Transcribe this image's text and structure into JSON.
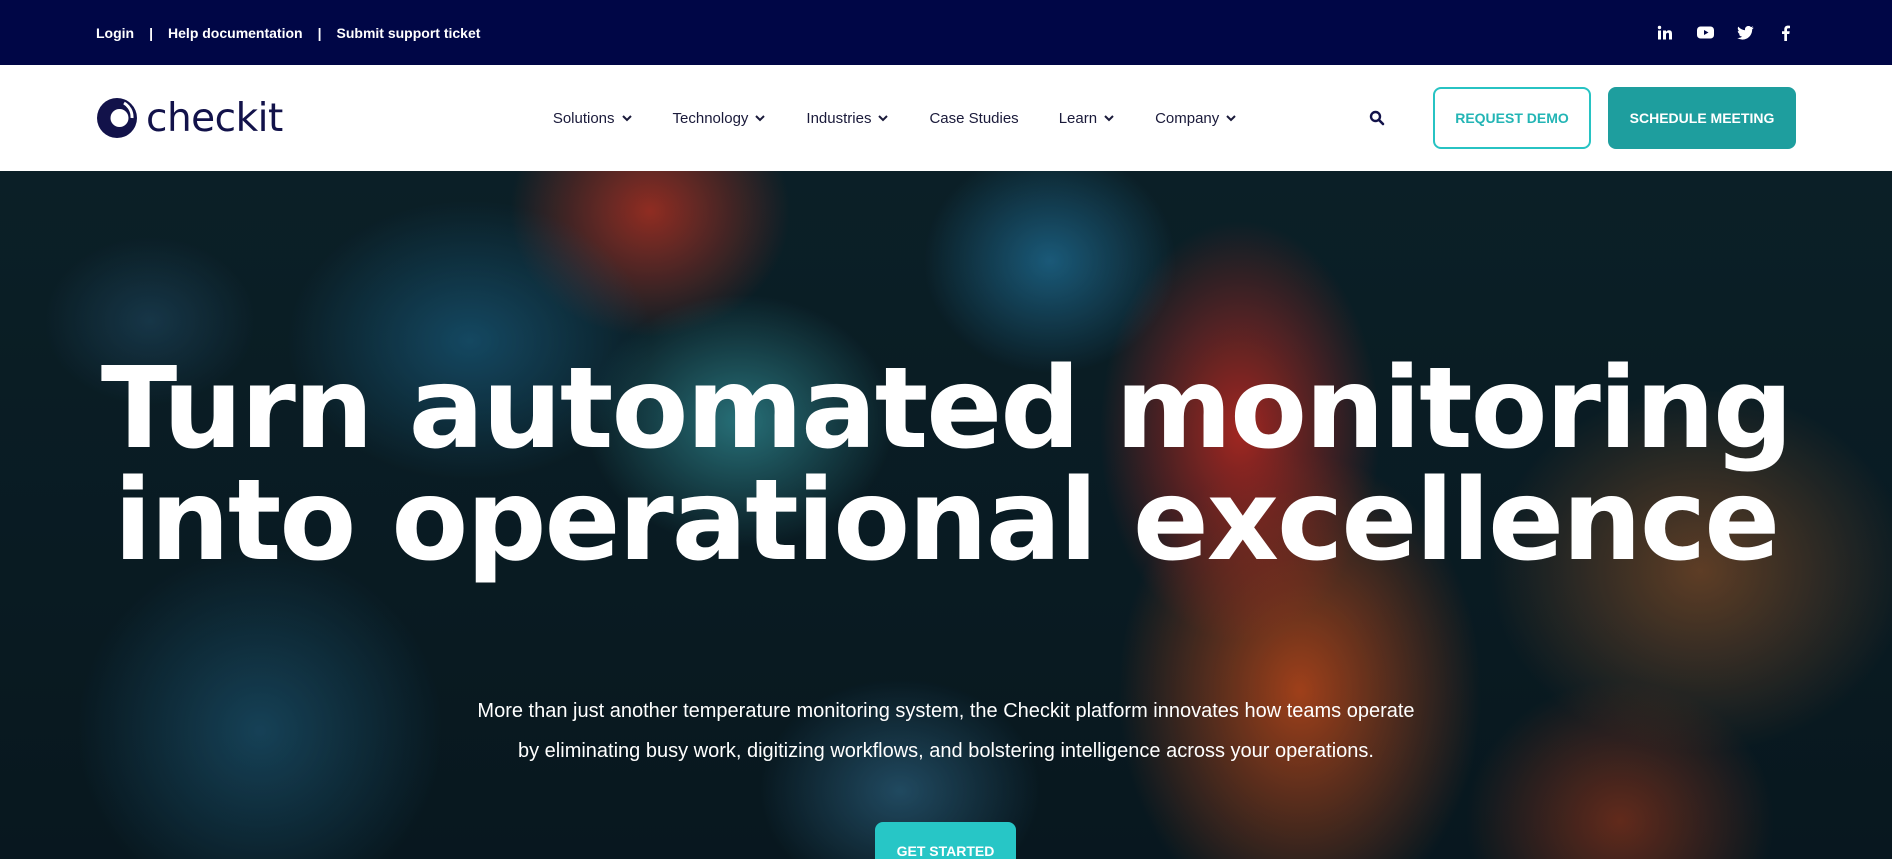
{
  "topbar": {
    "links": [
      "Login",
      "Help documentation",
      "Submit support ticket"
    ],
    "separator": "|",
    "social_icons": [
      "linkedin-icon",
      "youtube-icon",
      "twitter-icon",
      "facebook-icon"
    ],
    "background": "#000646"
  },
  "nav": {
    "logo_text": "checkit",
    "menu": [
      {
        "label": "Solutions",
        "has_dropdown": true
      },
      {
        "label": "Technology",
        "has_dropdown": true
      },
      {
        "label": "Industries",
        "has_dropdown": true
      },
      {
        "label": "Case Studies",
        "has_dropdown": false
      },
      {
        "label": "Learn",
        "has_dropdown": true
      },
      {
        "label": "Company",
        "has_dropdown": true
      }
    ],
    "search_icon": "search-icon",
    "request_demo": "REQUEST DEMO",
    "schedule_meeting": "SCHEDULE MEETING",
    "accent": "#1e9e9e"
  },
  "hero": {
    "title_line1": "Turn automated monitoring",
    "title_line2": "into operational excellence",
    "subtitle_line1": "More than just another temperature monitoring system, the Checkit platform innovates how teams operate",
    "subtitle_line2": "by eliminating busy work, digitizing workflows, and bolstering intelligence across your operations.",
    "cta": "GET STARTED"
  }
}
